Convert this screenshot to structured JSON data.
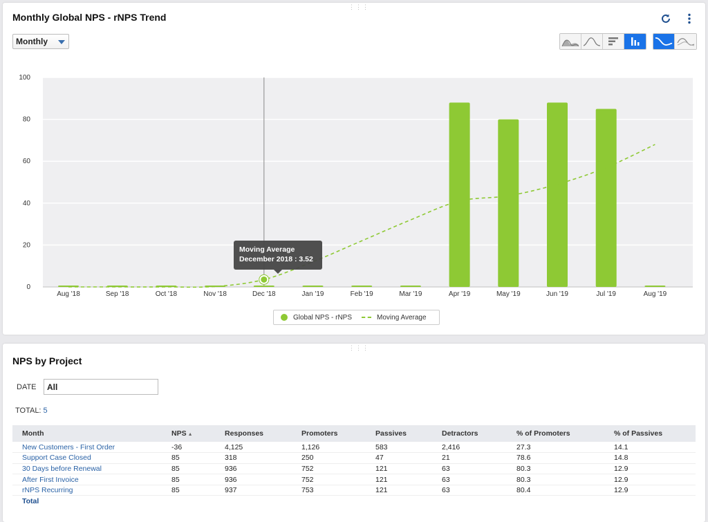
{
  "panel1": {
    "title": "Monthly Global NPS - rNPS Trend",
    "period_select": "Monthly",
    "tooltip": {
      "title": "Moving Average",
      "value": "December 2018 : 3.52"
    },
    "legend": [
      {
        "label": "Global NPS - rNPS",
        "kind": "bar"
      },
      {
        "label": "Moving Average",
        "kind": "dashed-line"
      }
    ],
    "toolbar_icons": [
      "refresh-icon",
      "more-vert-icon",
      "area-chart-icon",
      "line-chart-icon",
      "horizontal-bar-icon",
      "column-chart-icon",
      "smooth-line-icon",
      "smooth-area-icon"
    ]
  },
  "chart_data": {
    "type": "bar",
    "categories": [
      "Aug '18",
      "Sep '18",
      "Oct '18",
      "Nov '18",
      "Dec '18",
      "Jan '19",
      "Feb '19",
      "Mar '19",
      "Apr '19",
      "May '19",
      "Jun '19",
      "Jul '19",
      "Aug '19"
    ],
    "series": [
      {
        "name": "Global NPS - rNPS",
        "type": "bar",
        "color": "#8ec934",
        "values": [
          0,
          0,
          0,
          0,
          0,
          0,
          0,
          0,
          88,
          80,
          88,
          85,
          0
        ]
      },
      {
        "name": "Moving Average",
        "type": "line",
        "dashed": true,
        "color": "#8ec934",
        "values": [
          0,
          0,
          0,
          0.2,
          3.52,
          12,
          22,
          32,
          41,
          43.5,
          49,
          57,
          68
        ]
      }
    ],
    "yticks": [
      0,
      20,
      40,
      60,
      80,
      100
    ],
    "ylim": [
      0,
      100
    ],
    "grid": true,
    "legend_position": "bottom-center",
    "highlighted_category": "Dec '18"
  },
  "panel2": {
    "title": "NPS by Project",
    "filter": {
      "label": "DATE",
      "value": "All"
    },
    "total_label": "TOTAL:",
    "total_count": "5",
    "columns": [
      "Month",
      "NPS",
      "Responses",
      "Promoters",
      "Passives",
      "Detractors",
      "% of Promoters",
      "% of Passives"
    ],
    "sort_indicator": "▲",
    "rows": [
      [
        "New Customers - First Order",
        "-36",
        "4,125",
        "1,126",
        "583",
        "2,416",
        "27.3",
        "14.1"
      ],
      [
        "Support Case Closed",
        "85",
        "318",
        "250",
        "47",
        "21",
        "78.6",
        "14.8"
      ],
      [
        "30 Days before Renewal",
        "85",
        "936",
        "752",
        "121",
        "63",
        "80.3",
        "12.9"
      ],
      [
        "After First Invoice",
        "85",
        "936",
        "752",
        "121",
        "63",
        "80.3",
        "12.9"
      ],
      [
        "rNPS Recurring",
        "85",
        "937",
        "753",
        "121",
        "63",
        "80.4",
        "12.9"
      ]
    ],
    "total_row_label": "Total"
  },
  "colors": {
    "accent": "#1a73e8",
    "bar": "#8ec934",
    "link": "#2a62a6",
    "plot_bg": "#efeff1"
  }
}
